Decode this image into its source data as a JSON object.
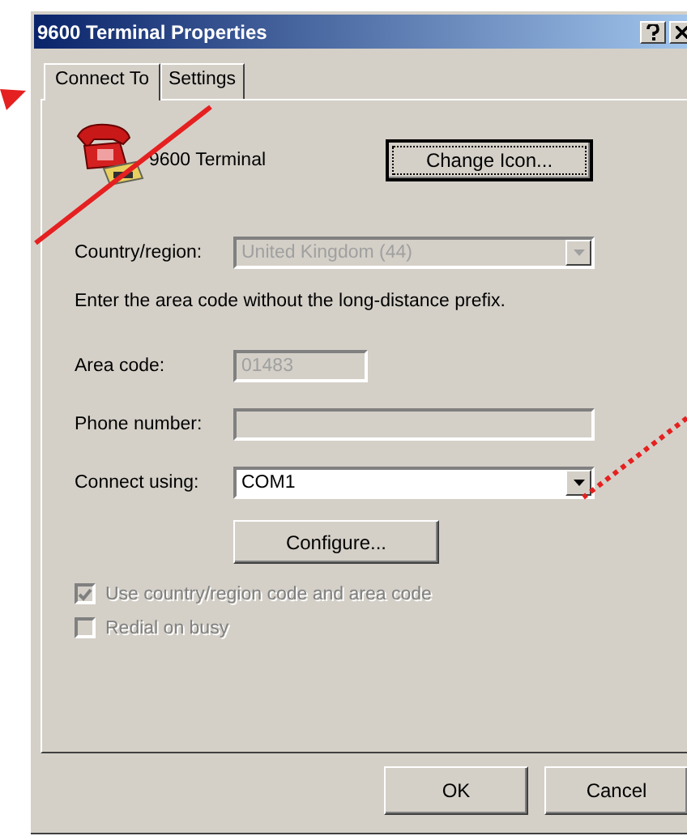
{
  "window": {
    "title": "9600 Terminal Properties"
  },
  "tabs": [
    {
      "label": "Connect To",
      "selected": true
    },
    {
      "label": "Settings",
      "selected": false
    }
  ],
  "device": {
    "name": "9600 Terminal"
  },
  "change_icon_button": "Change Icon...",
  "fields": [
    {
      "label": "Country/region:",
      "value": "United Kingdom (44)",
      "kind": "dropdown",
      "disabled": true,
      "wide": true
    },
    {
      "kind": "hint",
      "label": "Enter the area code without the long-distance prefix."
    },
    {
      "label": "Area code:",
      "value": "01483",
      "kind": "text",
      "disabled": true,
      "wide": false
    },
    {
      "label": "Phone number:",
      "kind": "text",
      "disabled": true,
      "wide": true
    },
    {
      "label": "Connect using:",
      "value": "COM1",
      "kind": "dropdown",
      "disabled": false,
      "wide": true
    }
  ],
  "configure_button": "Configure...",
  "checkboxes": [
    {
      "label": "Use country/region code and area code",
      "checked": true,
      "disabled": true
    },
    {
      "label": "Redial on busy",
      "checked": false,
      "disabled": true
    }
  ],
  "buttons": [
    "OK",
    "Cancel"
  ]
}
